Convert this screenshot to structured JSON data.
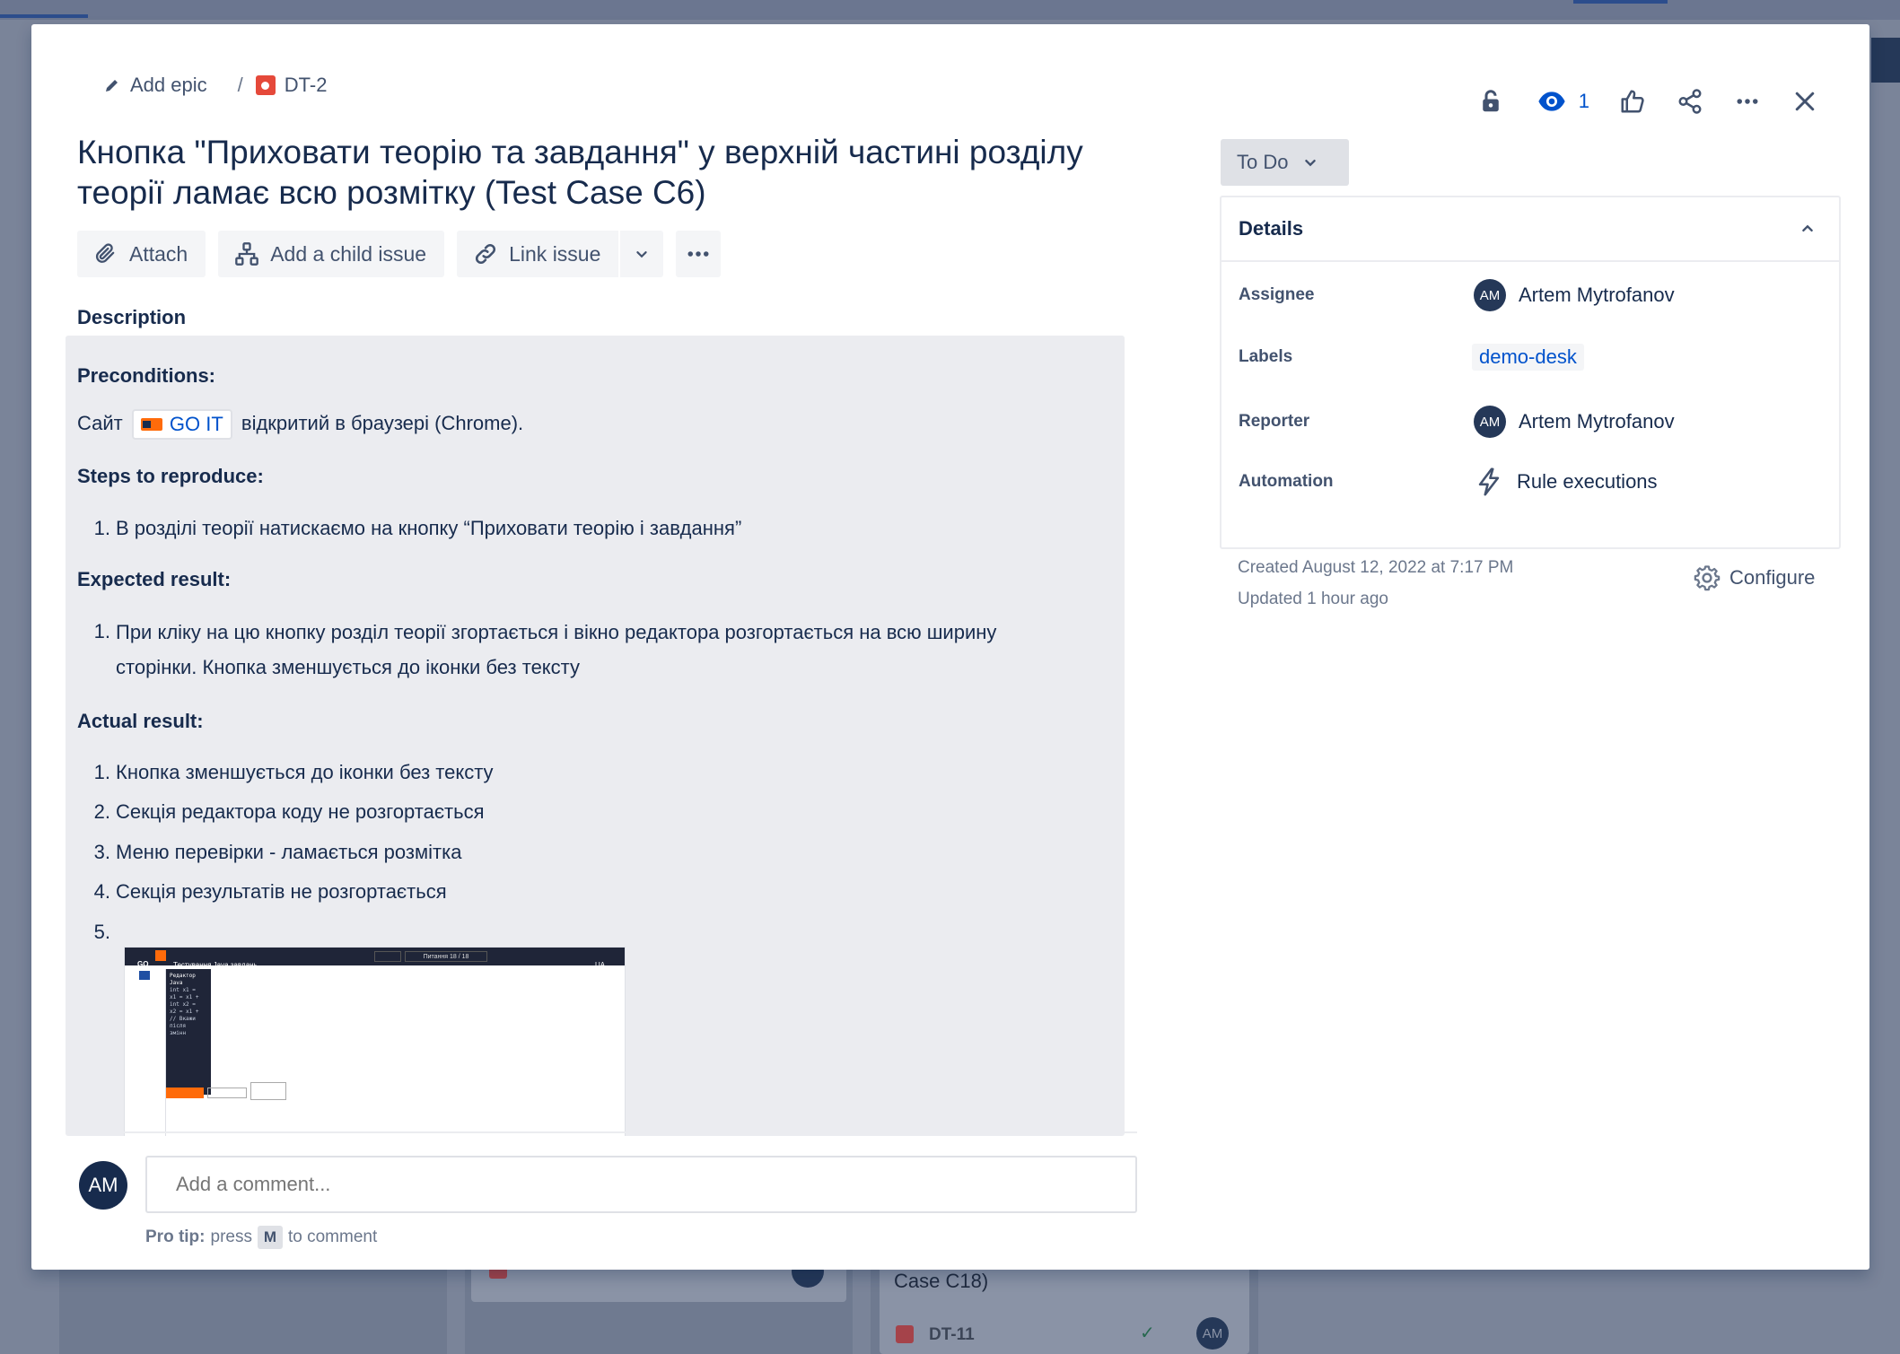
{
  "breadcrumb": {
    "epic_label": "Add epic",
    "separator": "/",
    "issue_key": "DT-2"
  },
  "header": {
    "watch_count": "1",
    "icons": [
      "lock-icon",
      "eye-icon",
      "thumbs-up-icon",
      "share-icon",
      "more-icon",
      "close-icon"
    ]
  },
  "issue": {
    "title": "Кнопка \"Приховати теорію та завдання\" у верхній частині розділу теорії ламає всю розмітку (Test Case C6)"
  },
  "toolbar": {
    "attach_label": "Attach",
    "child_issue_label": "Add a child issue",
    "link_issue_label": "Link issue"
  },
  "description": {
    "label": "Description",
    "preconditions_heading": "Preconditions:",
    "precondition_prefix": "Сайт",
    "precondition_link": "GO IT",
    "precondition_suffix": "відкритий в браузері (Chrome).",
    "steps_heading": "Steps to reproduce:",
    "steps": [
      {
        "n": "1.",
        "text": "В розділі теорії натискаємо на кнопку “Приховати теорію і завдання”"
      }
    ],
    "expected_heading": "Expected result:",
    "expected": [
      {
        "n": "1.",
        "text_line1": "При кліку на цю кнопку розділ теорії згортається і вікно редактора розгортається на всю ширину",
        "text_line2": "сторінки. Кнопка зменшується до іконки без тексту"
      }
    ],
    "actual_heading": "Actual result:",
    "actual": [
      {
        "n": "1.",
        "text": "Кнопка зменшується до іконки без тексту"
      },
      {
        "n": "2.",
        "text": "Секція редактора коду не розгортається"
      },
      {
        "n": "3.",
        "text": "Меню перевірки - ламається розмітка"
      },
      {
        "n": "4.",
        "text": "Секція результатів не розгортається"
      },
      {
        "n": "5.",
        "text": ""
      }
    ],
    "attachment": {
      "logo_text": "GO",
      "page_title": "Тестування Java завдань",
      "question_counter": "Питання 18 / 18",
      "lang": "UA",
      "editor_label": "Редактор Java",
      "code": [
        "int x1 =",
        "x1 = x1 +",
        "int x2 =",
        "x2 = x1 +",
        "// Вкажи",
        "після",
        "змінн"
      ]
    }
  },
  "comment": {
    "avatar_initials": "AM",
    "placeholder": "Add a comment...",
    "protip_label": "Pro tip:",
    "protip_press": "press",
    "protip_key": "M",
    "protip_suffix": "to comment"
  },
  "status": {
    "label": "To Do"
  },
  "details": {
    "heading": "Details",
    "assignee_label": "Assignee",
    "assignee_initials": "AM",
    "assignee_name": "Artem Mytrofanov",
    "labels_label": "Labels",
    "labels_value": "demo-desk",
    "reporter_label": "Reporter",
    "reporter_initials": "AM",
    "reporter_name": "Artem Mytrofanov",
    "automation_label": "Automation",
    "automation_value": "Rule executions"
  },
  "meta": {
    "created": "Created August 12, 2022 at 7:17 PM",
    "updated": "Updated 1 hour ago",
    "configure_label": "Configure"
  },
  "backdrop": {
    "card_text": "Case C18)",
    "card_key": "DT-11",
    "card_avatar": "AM"
  },
  "colors": {
    "accent": "#0052cc",
    "bug": "#e5493a",
    "text": "#172b4d",
    "subtle": "#42526e"
  }
}
